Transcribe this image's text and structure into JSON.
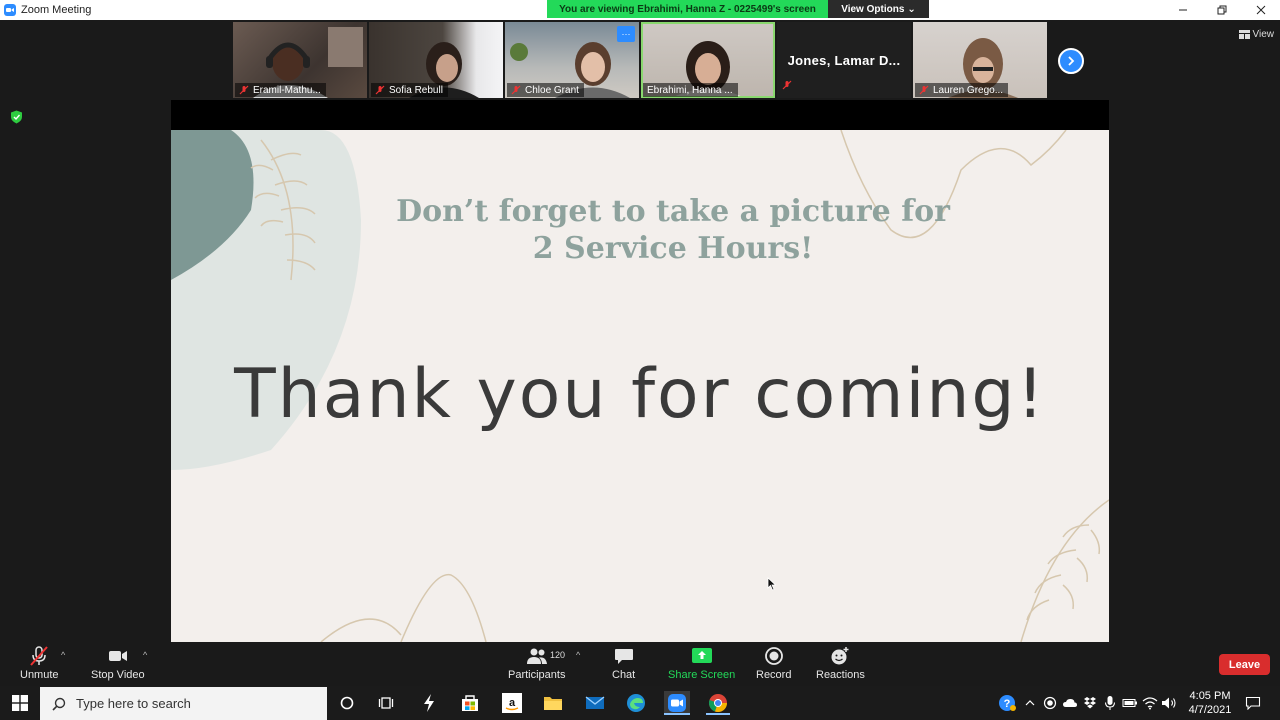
{
  "window": {
    "title": "Zoom Meeting",
    "share_banner": "You are viewing Ebrahimi, Hanna Z - 0225499's screen",
    "view_options_label": "View Options",
    "view_options_caret": "⌄"
  },
  "participants_strip": {
    "tiles": [
      {
        "name": "Eramil-Mathu..."
      },
      {
        "name": "Sofia Rebull"
      },
      {
        "name": "Chloe Grant",
        "more": "···"
      },
      {
        "name": "Ebrahimi, Hanna ..."
      },
      {
        "display_text": "Jones,  Lamar D..."
      },
      {
        "name": "Lauren Grego..."
      }
    ],
    "view_label": "View"
  },
  "slide": {
    "subtitle_line1": "Don’t forget to take a picture for",
    "subtitle_line2": "2 Service Hours!",
    "main_text": "Thank you for coming!",
    "colors": {
      "background": "#f3efec",
      "subtitle": "#8ea29d",
      "main": "#3a3a3a",
      "blob_dark": "#7e9894",
      "blob_light": "#dfe5e2",
      "leaf": "#d6c7ae"
    }
  },
  "toolbar": {
    "unmute_label": "Unmute",
    "stop_video_label": "Stop Video",
    "participants_label": "Participants",
    "participant_count": "120",
    "chat_label": "Chat",
    "share_screen_label": "Share Screen",
    "record_label": "Record",
    "reactions_label": "Reactions",
    "leave_label": "Leave",
    "caret": "^"
  },
  "taskbar": {
    "search_placeholder": "Type here to search",
    "time": "4:05 PM",
    "date": "4/7/2021",
    "help_badge": "?"
  }
}
